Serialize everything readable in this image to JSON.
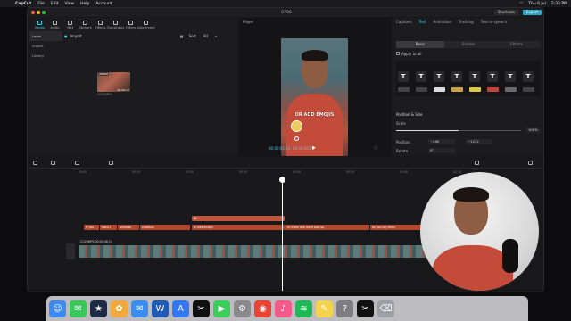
{
  "menubar": {
    "apple": "",
    "app": "CapCut",
    "items": [
      "File",
      "Edit",
      "View",
      "Help",
      "Account"
    ],
    "right_date": "Thu 6 Jul",
    "right_time": "2:32 PM"
  },
  "window": {
    "title": "0706",
    "shortcuts_label": "Shortcuts",
    "export_label": "Export"
  },
  "media_tabs": [
    {
      "label": "Media",
      "icon": "media-icon",
      "active": true
    },
    {
      "label": "Audio",
      "icon": "audio-icon"
    },
    {
      "label": "Text",
      "icon": "text-icon"
    },
    {
      "label": "Stickers",
      "icon": "sticker-icon"
    },
    {
      "label": "Effects",
      "icon": "effects-icon"
    },
    {
      "label": "Transitions",
      "icon": "transitions-icon"
    },
    {
      "label": "Filters",
      "icon": "filters-icon"
    },
    {
      "label": "Adjustment",
      "icon": "adjustment-icon"
    }
  ],
  "media_side": [
    "Local",
    "Import",
    "Library"
  ],
  "media_main": {
    "import_label": "Import",
    "sort_label": "Sort",
    "all_label": "All",
    "thumb_added": "Added",
    "thumb_duration": "00:00:12",
    "thumb_name": "CO2SMPS"
  },
  "player": {
    "header": "Player",
    "caption": "OR ADD EMOJIS",
    "current_time": "00:00:05:16",
    "total_time": "00:00:06:15",
    "emoji": "😊"
  },
  "props": {
    "tabs": [
      "Captions",
      "Text",
      "Animation",
      "Tracking",
      "Text-to-speech"
    ],
    "active_tab": "Text",
    "subtabs": [
      "Basic",
      "Bubble",
      "Effects"
    ],
    "apply_all": "Apply to all",
    "section_title": "Position & Size",
    "scale_label": "Scale",
    "scale_value": "100%",
    "scale_fraction": 0.5,
    "position_label": "Position",
    "pos_x": "−490",
    "pos_y": "−1012",
    "rotate_label": "Rotate",
    "rotate_value": "0°",
    "presets": [
      "T",
      "T",
      "T",
      "T",
      "T",
      "T",
      "T",
      "T"
    ],
    "pill_colors": [
      "#444",
      "#444",
      "#ddd",
      "#c9a24a",
      "#d9c64b",
      "#c0443a",
      "#6a6a6a",
      "#444"
    ]
  },
  "timeline": {
    "ruler_ticks": [
      "00:00",
      "00:10",
      "00:20",
      "00:30",
      "00:40",
      "00:50",
      "01:00",
      "01:10"
    ],
    "sticker_clip": "😊",
    "caption_clips": [
      "If you",
      "want t",
      "animate",
      "captions",
      "or add emojis",
      "or make one word pop up",
      "as you say them"
    ],
    "video_track_label": "CO2SMPS  00:00:06:15"
  },
  "dock": {
    "icons": [
      "finder-icon",
      "messages-icon",
      "clips-icon",
      "photos-icon",
      "mail-icon",
      "word-icon",
      "appstore-icon",
      "capcut-icon",
      "facetime-icon",
      "settings-icon",
      "chrome-icon",
      "itunes-icon",
      "spotify-icon",
      "notes-icon",
      "help-icon",
      "capcut-icon",
      "trash-icon"
    ]
  }
}
